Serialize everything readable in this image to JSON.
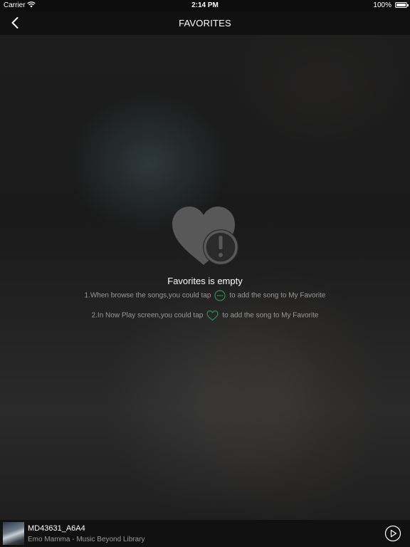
{
  "status_bar": {
    "carrier": "Carrier",
    "time": "2:14 PM",
    "battery": "100%"
  },
  "nav": {
    "title": "FAVORITES"
  },
  "empty_state": {
    "title": "Favorites is empty",
    "hint1_before": "1.When browse the songs,you could tap",
    "hint1_after": "to add the song to My Favorite",
    "hint2_before": "2.In Now Play screen,you could tap",
    "hint2_after": "to add the song to My Favorite"
  },
  "player": {
    "song": "MD43631_A6A4",
    "artist": "Emo Mamma - Music Beyond Library"
  },
  "colors": {
    "accent": "#2e8b57",
    "hint_text": "#9a9a9a",
    "icon_gray": "#555555"
  }
}
